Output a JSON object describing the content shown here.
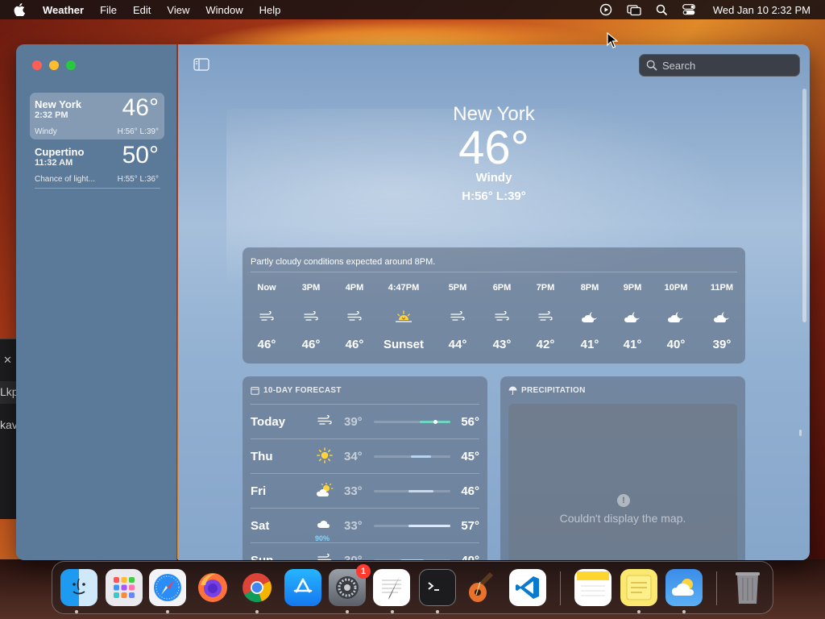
{
  "menubar": {
    "app_name": "Weather",
    "menus": [
      "File",
      "Edit",
      "View",
      "Window",
      "Help"
    ],
    "clock": "Wed Jan 10  2:32 PM",
    "status_icons": [
      "play-circle-icon",
      "screen-mirroring-icon",
      "spotlight-search-icon",
      "control-center-icon"
    ]
  },
  "background_window": {
    "close": "✕",
    "text1": "Lkp",
    "text2": "kav"
  },
  "sidebar": {
    "cities": [
      {
        "name": "New York",
        "time": "2:32 PM",
        "temp": "46°",
        "condition": "Windy",
        "hl": "H:56°  L:39°",
        "selected": true
      },
      {
        "name": "Cupertino",
        "time": "11:32 AM",
        "temp": "50°",
        "condition": "Chance of light...",
        "hl": "H:55°  L:36°",
        "selected": false
      }
    ]
  },
  "search": {
    "placeholder": "Search"
  },
  "hero": {
    "city": "New York",
    "temp": "46°",
    "condition": "Windy",
    "hl": "H:56°  L:39°"
  },
  "hourly": {
    "summary": "Partly cloudy conditions expected around 8PM.",
    "hours": [
      {
        "label": "Now",
        "icon": "wind",
        "temp": "46°"
      },
      {
        "label": "3PM",
        "icon": "wind",
        "temp": "46°"
      },
      {
        "label": "4PM",
        "icon": "wind",
        "temp": "46°"
      },
      {
        "label": "4:47PM",
        "icon": "sunset",
        "temp": "Sunset"
      },
      {
        "label": "5PM",
        "icon": "wind",
        "temp": "44°"
      },
      {
        "label": "6PM",
        "icon": "wind",
        "temp": "43°"
      },
      {
        "label": "7PM",
        "icon": "wind",
        "temp": "42°"
      },
      {
        "label": "8PM",
        "icon": "cloud-moon",
        "temp": "41°"
      },
      {
        "label": "9PM",
        "icon": "cloud-moon",
        "temp": "41°"
      },
      {
        "label": "10PM",
        "icon": "cloud-moon",
        "temp": "40°"
      },
      {
        "label": "11PM",
        "icon": "cloud-moon",
        "temp": "39°"
      }
    ]
  },
  "forecast": {
    "title": "10-DAY FORECAST",
    "days": [
      {
        "day": "Today",
        "icon": "wind",
        "lo": "39°",
        "hi": "56°",
        "precip": "",
        "range": [
          0.6,
          1.0
        ],
        "color": "#6fd6c3"
      },
      {
        "day": "Thu",
        "icon": "sun",
        "lo": "34°",
        "hi": "45°",
        "precip": "",
        "range": [
          0.48,
          0.75
        ],
        "color": "#b9d4f0"
      },
      {
        "day": "Fri",
        "icon": "sun-cloud",
        "lo": "33°",
        "hi": "46°",
        "precip": "",
        "range": [
          0.45,
          0.78
        ],
        "color": "#c9d8ea"
      },
      {
        "day": "Sat",
        "icon": "cloud-rain",
        "lo": "33°",
        "hi": "57°",
        "precip": "90%",
        "range": [
          0.45,
          1.0
        ],
        "color": "#dfe8f2"
      },
      {
        "day": "Sun",
        "icon": "wind",
        "lo": "30°",
        "hi": "40°",
        "precip": "",
        "range": [
          0.35,
          0.65
        ],
        "color": "#b9d4f0"
      }
    ]
  },
  "precipitation": {
    "title": "PRECIPITATION",
    "message": "Couldn't display the map.",
    "info_glyph": "!"
  },
  "dock": {
    "apps": [
      "finder-icon",
      "launchpad-icon",
      "safari-icon",
      "firefox-icon",
      "chrome-icon",
      "app-store-icon",
      "system-settings-icon",
      "textedit-icon",
      "terminal-icon",
      "garageband-icon",
      "vscode-icon",
      "notes-icon",
      "stickies-icon",
      "weather-icon",
      "trash-icon"
    ],
    "settings_badge": "1"
  },
  "colors": {
    "accent_teal": "#6fd6c3",
    "close": "#ff5f57",
    "minimize": "#febc2e",
    "zoom": "#28c840",
    "badge": "#ff3b30",
    "precip_pct": "#7fd6ff"
  }
}
